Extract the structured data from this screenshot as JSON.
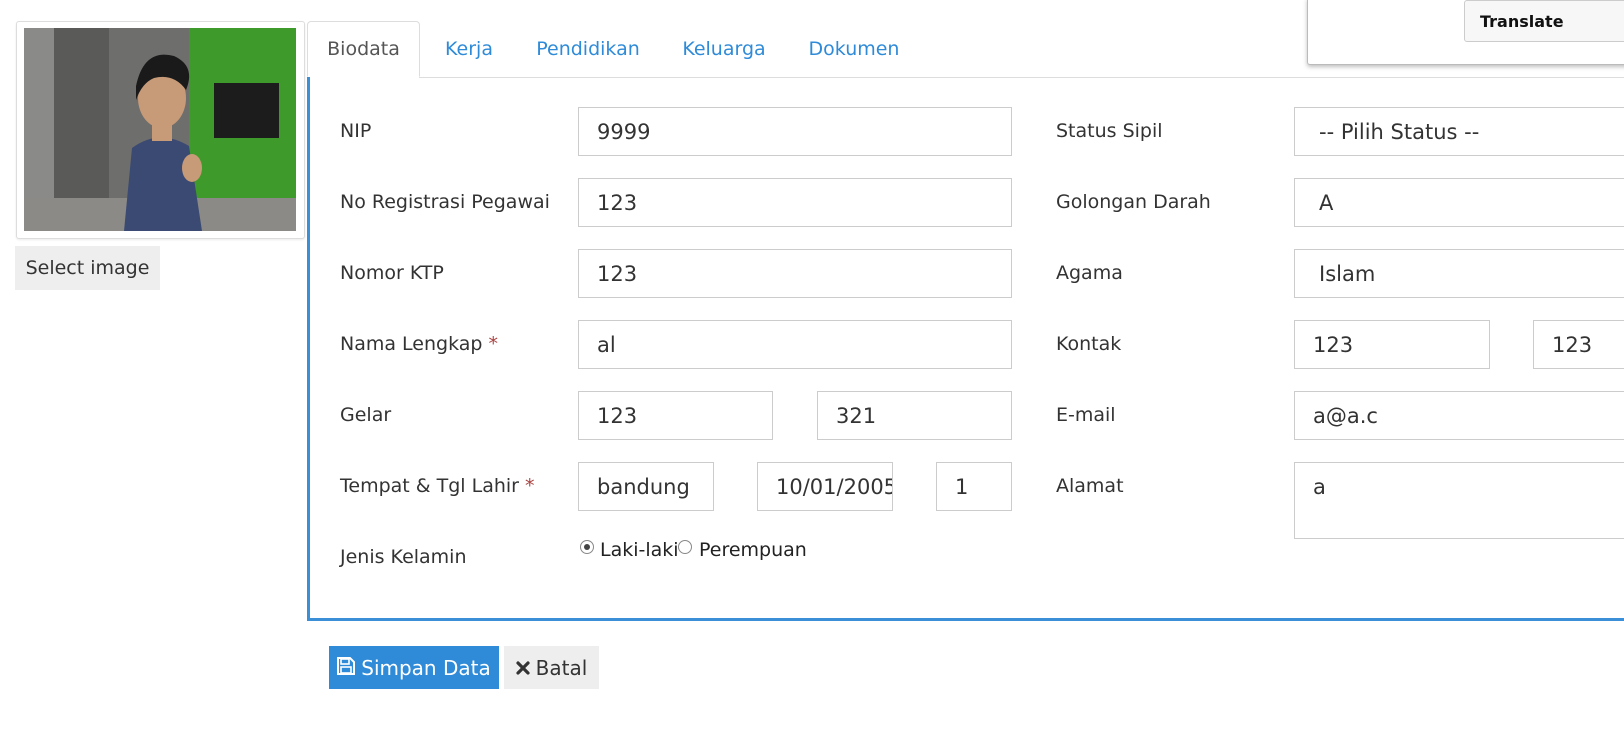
{
  "profile": {
    "select_image_label": "Select image"
  },
  "tabs": [
    "Biodata",
    "Kerja",
    "Pendidikan",
    "Keluarga",
    "Dokumen"
  ],
  "form": {
    "left": {
      "nip": {
        "label": "NIP",
        "value": "9999"
      },
      "no_reg": {
        "label": "No Registrasi Pegawai",
        "value": "123"
      },
      "ktp": {
        "label": "Nomor KTP",
        "value": "123"
      },
      "nama": {
        "label": "Nama Lengkap",
        "required_mark": "*",
        "value": "al"
      },
      "gelar": {
        "label": "Gelar",
        "front": "123",
        "back": "321"
      },
      "ttl": {
        "label": "Tempat & Tgl Lahir",
        "required_mark": "*",
        "tempat": "bandung",
        "tanggal": "10/01/2005",
        "extra": "1"
      },
      "jenis_kelamin": {
        "label": "Jenis Kelamin",
        "options": [
          "Laki-laki",
          "Perempuan"
        ],
        "selected": "Laki-laki"
      }
    },
    "right": {
      "status_sipil": {
        "label": "Status Sipil",
        "value": "-- Pilih Status --"
      },
      "golongan_darah": {
        "label": "Golongan Darah",
        "value": "A"
      },
      "agama": {
        "label": "Agama",
        "value": "Islam"
      },
      "kontak": {
        "label": "Kontak",
        "value1": "123",
        "value2": "123"
      },
      "email": {
        "label": "E-mail",
        "value": "a@a.c"
      },
      "alamat": {
        "label": "Alamat",
        "value": "a"
      }
    }
  },
  "actions": {
    "save_label": "Simpan Data",
    "cancel_label": "Batal"
  },
  "translate": {
    "label": "Translate"
  },
  "colors": {
    "accent": "#2f8bd8",
    "panel_border": "#3a8fd6",
    "required": "#a94442"
  }
}
